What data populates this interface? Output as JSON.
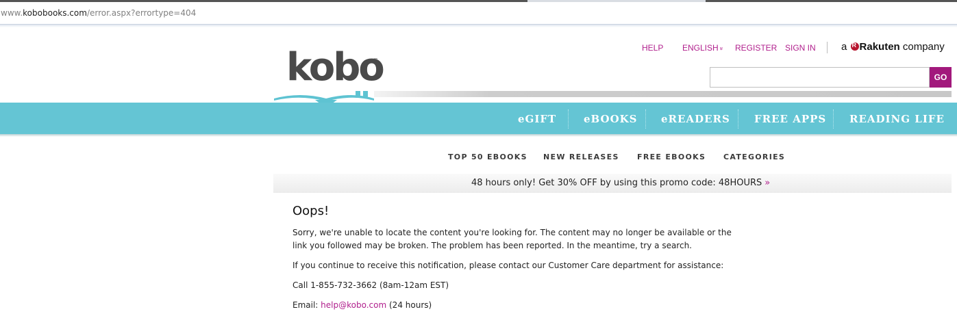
{
  "browser": {
    "url_prefix": "www.",
    "url_host": "kobobooks.com",
    "url_path": "/error.aspx?errortype=404"
  },
  "header": {
    "logo_text": "kobo",
    "logo_tm": "™",
    "links": [
      "HELP",
      "ENGLISH",
      "REGISTER",
      "SIGN IN"
    ],
    "language_caret": "»",
    "rakuten_prefix": "a",
    "rakuten_brand": "Rakuten",
    "rakuten_suffix": "company",
    "search_value": "",
    "search_button": "GO",
    "colors": {
      "brand_magenta": "#b1208d",
      "nav_teal": "#64c5d4",
      "logo_teal": "#5ec3d2"
    }
  },
  "nav": {
    "items": [
      "eGIFT",
      "eBOOKS",
      "eREADERS",
      "FREE APPS",
      "READING LIFE"
    ]
  },
  "subnav": {
    "items": [
      "TOP 50 EBOOKS",
      "NEW RELEASES",
      "FREE EBOOKS",
      "CATEGORIES"
    ]
  },
  "promo": {
    "text": "48 hours only! Get 30% OFF by using this promo code: 48HOURS",
    "arrow": "»"
  },
  "error": {
    "title": "Oops!",
    "p1_line1": "Sorry, we're unable to locate the content you're looking for. The content may no longer be available or the",
    "p1_line2": "link you followed may be broken. The problem has been reported. In the meantime, try a search.",
    "p2": "If you continue to receive this notification, please contact our Customer Care department for assistance:",
    "phone_line": "Call 1-855-732-3662 (8am-12am EST)",
    "email_label": "Email:",
    "email": "help@kobo.com",
    "email_hours": "(24 hours)"
  }
}
